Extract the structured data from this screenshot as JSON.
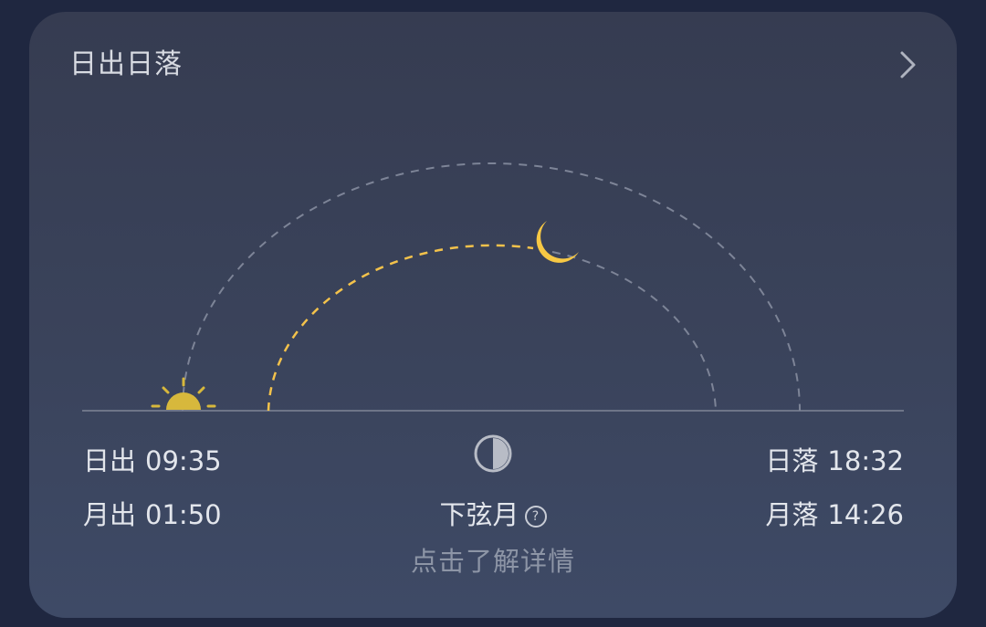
{
  "card": {
    "title": "日出日落"
  },
  "sun": {
    "rise_label": "日出",
    "rise_time": "09:35",
    "set_label": "日落",
    "set_time": "18:32"
  },
  "moon": {
    "rise_label": "月出",
    "rise_time": "01:50",
    "set_label": "月落",
    "set_time": "14:26",
    "phase_name": "下弦月",
    "help_glyph": "?"
  },
  "footer": {
    "details_link": "点击了解详情"
  },
  "colors": {
    "sun": "#e4c440",
    "moon": "#f7c844",
    "moon_path": "#f3c24b",
    "track": "#7d8497",
    "horizon": "#6e7588"
  },
  "icons": {
    "chevron": "chevron-right-icon",
    "sun": "sun-icon",
    "moon": "crescent-moon-icon",
    "phase": "half-moon-phase-icon",
    "help": "question-circle-icon"
  }
}
